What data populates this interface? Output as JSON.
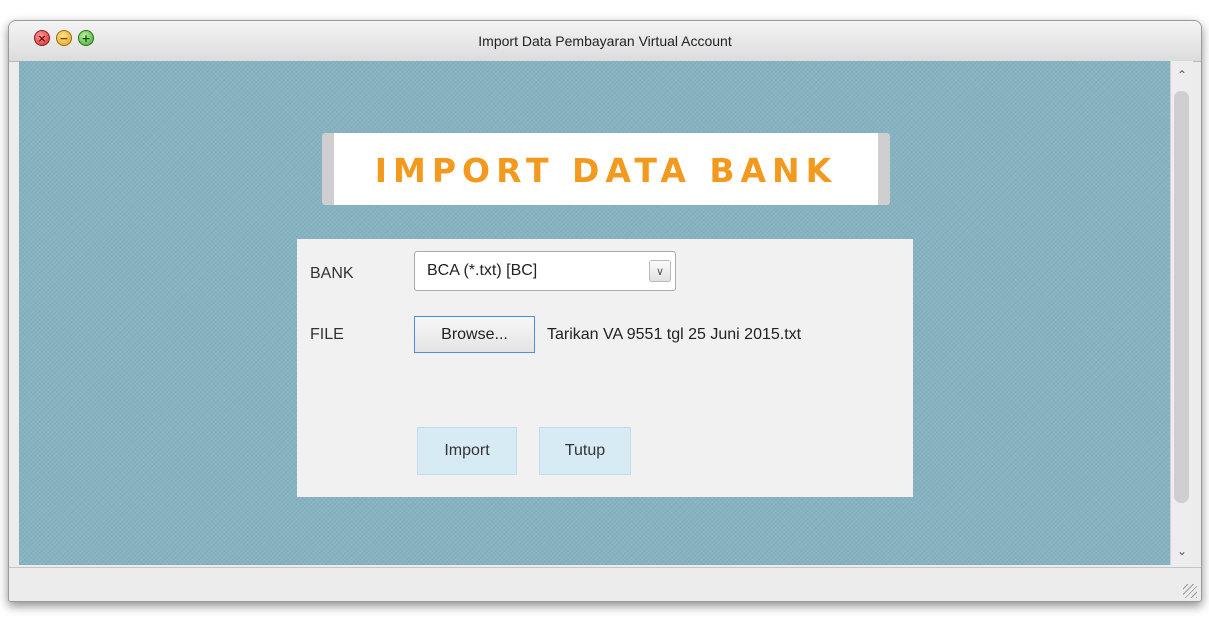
{
  "window": {
    "title": "Import Data Pembayaran Virtual Account",
    "controls": {
      "close_icon": "close-icon",
      "minimize_icon": "minimize-icon",
      "zoom_icon": "zoom-icon"
    }
  },
  "banner": {
    "title": "IMPORT DATA BANK",
    "color": "#f39a1e"
  },
  "form": {
    "bank_label": "BANK",
    "bank_selected": "BCA (*.txt) [BC]",
    "file_label": "FILE",
    "browse_label": "Browse...",
    "file_name": "Tarikan VA 9551 tgl 25 Juni 2015.txt"
  },
  "actions": {
    "import_label": "Import",
    "close_label": "Tutup"
  },
  "colors": {
    "background": "#86b3c2",
    "panel": "#f1f1f1",
    "action_button": "#d7ebf4"
  }
}
